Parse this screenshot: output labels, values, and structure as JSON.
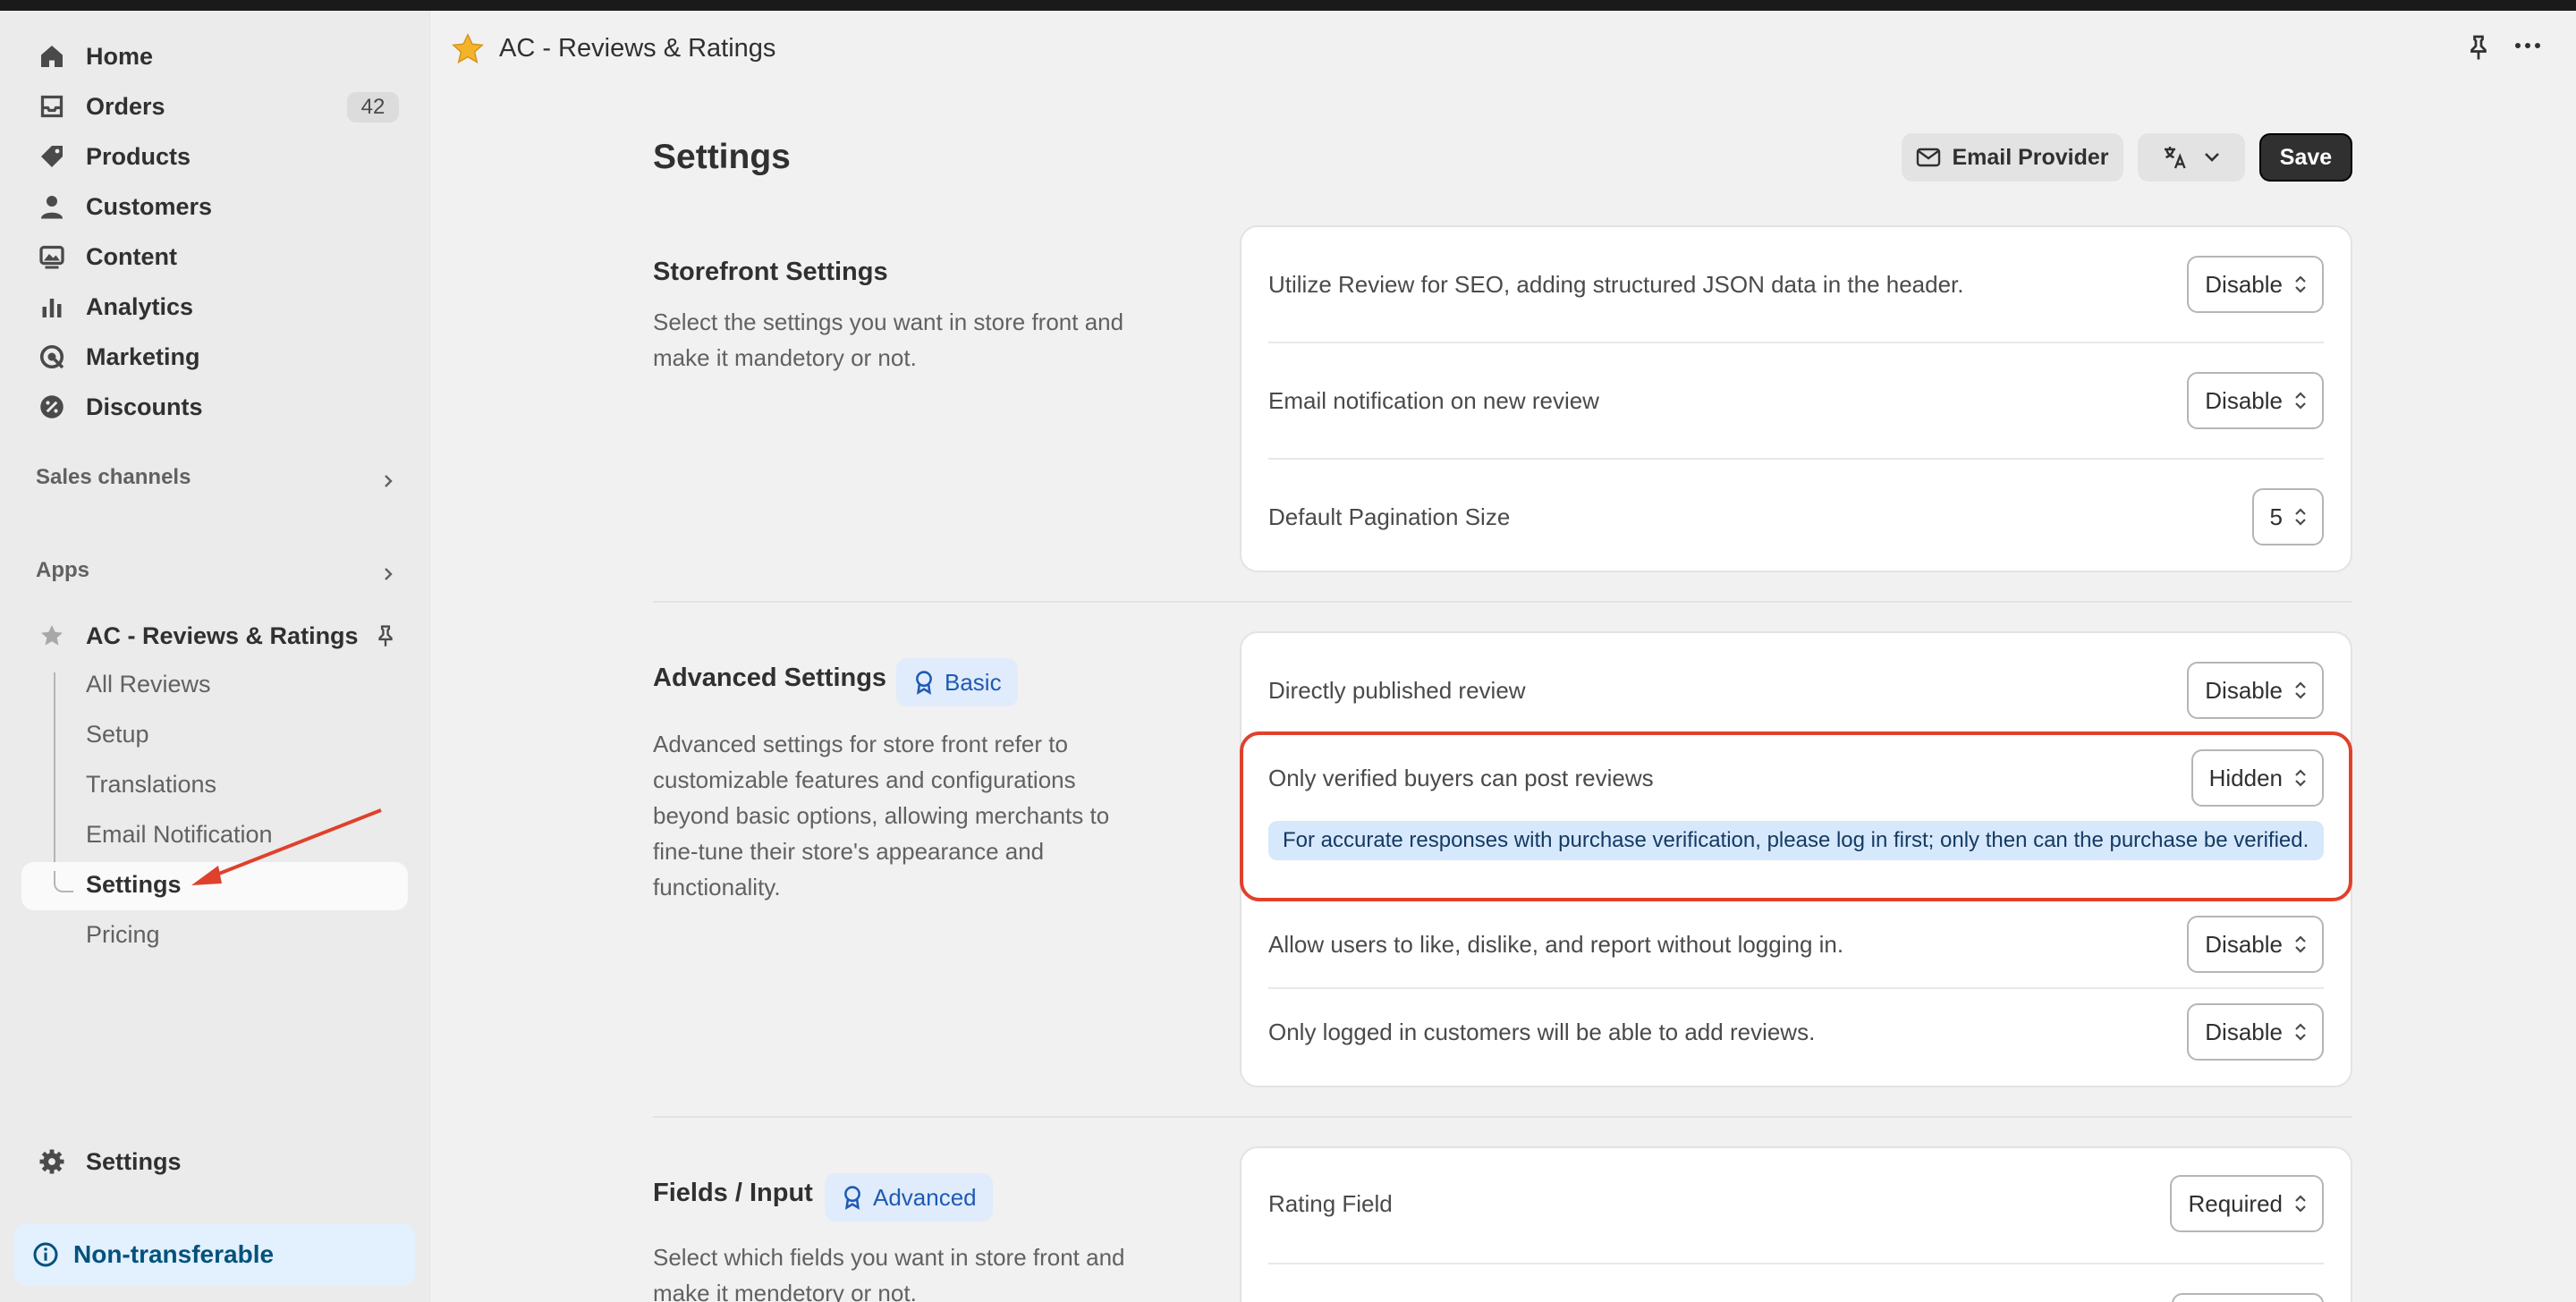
{
  "app": {
    "title": "AC - Reviews & Ratings"
  },
  "sidebar": {
    "nav": [
      {
        "label": "Home"
      },
      {
        "label": "Orders",
        "badge": "42"
      },
      {
        "label": "Products"
      },
      {
        "label": "Customers"
      },
      {
        "label": "Content"
      },
      {
        "label": "Analytics"
      },
      {
        "label": "Marketing"
      },
      {
        "label": "Discounts"
      }
    ],
    "sales_channels": "Sales channels",
    "apps": "Apps",
    "app_name": "AC - Reviews & Ratings",
    "app_subitems": [
      "All Reviews",
      "Setup",
      "Translations",
      "Email Notification",
      "Settings",
      "Pricing"
    ],
    "settings": "Settings",
    "non_transferable": "Non-transferable"
  },
  "page": {
    "title": "Settings",
    "email_provider_label": "Email Provider",
    "save_label": "Save"
  },
  "storefront": {
    "heading": "Storefront Settings",
    "description": "Select the settings you want in store front and make it mandetory or not.",
    "rows": [
      {
        "label": "Utilize Review for SEO, adding structured JSON data in the header.",
        "value": "Disable"
      },
      {
        "label": "Email notification on new review",
        "value": "Disable"
      },
      {
        "label": "Default Pagination Size",
        "value": "5"
      }
    ]
  },
  "advanced": {
    "heading": "Advanced Settings",
    "tag": "Basic",
    "description": "Advanced settings for store front refer to customizable features and configurations beyond basic options, allowing merchants to fine-tune their store's appearance and functionality.",
    "rows": [
      {
        "label": "Directly published review",
        "value": "Disable"
      },
      {
        "label": "Only verified buyers can post reviews",
        "value": "Hidden",
        "info": "For accurate responses with purchase verification, please log in first; only then can the purchase be verified."
      },
      {
        "label": "Allow users to like, dislike, and report without logging in.",
        "value": "Disable"
      },
      {
        "label": "Only logged in customers will be able to add reviews.",
        "value": "Disable"
      }
    ]
  },
  "fields": {
    "heading": "Fields / Input",
    "tag": "Advanced",
    "description": "Select which fields you want in store front and make it mendetory or not.",
    "rows": [
      {
        "label": "Rating Field",
        "value": "Required"
      }
    ]
  },
  "colors": {
    "accent_red": "#e0412c",
    "info_bg": "#d6e8fb",
    "save_bg": "#303030"
  }
}
